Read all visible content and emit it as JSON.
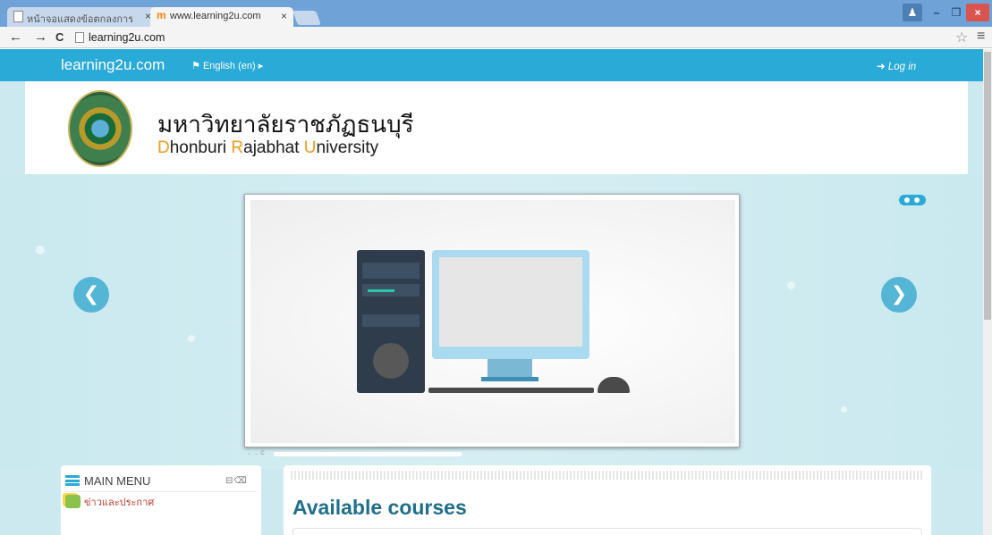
{
  "browser": {
    "tabs": [
      {
        "title": "หน้าจอแสดงข้อตกลงการใช้งาน",
        "active": false
      },
      {
        "title": "www.learning2u.com",
        "active": true
      }
    ],
    "tab_close": "×",
    "address": "learning2u.com",
    "nav": {
      "back": "←",
      "forward": "→",
      "reload": "C"
    },
    "star": "☆",
    "menu": "≡",
    "window": {
      "minimize": "–",
      "maximize": "❐",
      "close": "×"
    }
  },
  "site_nav": {
    "brand": "learning2u.com",
    "language": "English (en)",
    "login": "Log in"
  },
  "header": {
    "university_thai": "มหาวิทยาลัยราชภัฏธนบุรี",
    "university_eng": [
      {
        "initial": "D",
        "rest": "honburi "
      },
      {
        "initial": "R",
        "rest": "ajabhat "
      },
      {
        "initial": "U",
        "rest": "niversity"
      }
    ]
  },
  "slider": {
    "prev_icon": "chevron-left-icon",
    "next_icon": "chevron-right-icon",
    "mini_nav": "← → C"
  },
  "main_menu": {
    "title": "MAIN MENU",
    "item": "ข่าวและประกาศ"
  },
  "content": {
    "heading": "Available courses"
  },
  "colors": {
    "nav_blue": "#2aaad6",
    "page_bg": "#cde9f0",
    "heading": "#1f6f8b",
    "news_link": "#c0392b",
    "accent_orange": "#f0a020"
  }
}
